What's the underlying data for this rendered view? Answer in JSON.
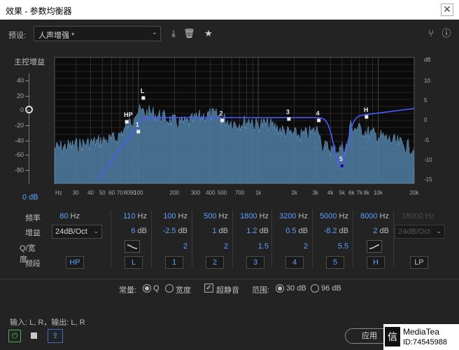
{
  "window": {
    "title": "效果 - 参数均衡器",
    "close_glyph": "✕"
  },
  "preset": {
    "label": "预设:",
    "value": "人声增强 *"
  },
  "toolbar": {
    "save_glyph": "⤓",
    "delete_glyph": "🗑",
    "favorite_glyph": "★",
    "route_glyph": "⑂",
    "info_glyph": "ⓘ"
  },
  "master": {
    "label": "主控增益",
    "value": "0 dB",
    "ticks": [
      "40",
      "20",
      "0",
      "-20",
      "-40",
      "-60",
      "-80"
    ]
  },
  "graph": {
    "db_label": "dB",
    "right_db_ticks": [
      "dB",
      "10",
      "5",
      "0",
      "-5",
      "-10",
      "-15"
    ],
    "freq_ticks": [
      "Hz",
      "30",
      "40",
      "50",
      "60",
      "70",
      "80",
      "90",
      "100",
      "200",
      "300",
      "400",
      "500",
      "700",
      "1k",
      "2k",
      "3k",
      "4k",
      "5k",
      "6k",
      "7k",
      "8k",
      "10k",
      "20k"
    ],
    "colors": {
      "background": "#0b0b0b",
      "spectrum": "#4f7fa6",
      "curve": "#4a5cff",
      "grid": "#4a4a4a"
    },
    "nodes": [
      {
        "label": "HP",
        "freq": 80,
        "gain": -28
      },
      {
        "label": "L",
        "freq": 110,
        "gain": 12
      },
      {
        "label": "1",
        "freq": 100,
        "gain": -40
      },
      {
        "label": "2",
        "freq": 500,
        "gain": 0
      },
      {
        "label": "3",
        "freq": 1800,
        "gain": 2
      },
      {
        "label": "4",
        "freq": 3200,
        "gain": 0
      },
      {
        "label": "5",
        "freq": 5000,
        "gain": -65
      },
      {
        "label": "H",
        "freq": 8000,
        "gain": 5
      }
    ]
  },
  "rows": {
    "freq_label": "频率",
    "gain_label": "增益",
    "q_label": "Q/宽度",
    "band_label": "频段",
    "hz": "Hz",
    "db": "dB"
  },
  "hp": {
    "freq": "80",
    "slope": "24dB/Oct",
    "band": "HP"
  },
  "bands": [
    {
      "freq": "110",
      "gain": "6",
      "q": "~",
      "band": "L",
      "shape": "low-shelf"
    },
    {
      "freq": "100",
      "gain": "-2.5",
      "q": "2",
      "band": "1"
    },
    {
      "freq": "500",
      "gain": "1",
      "q": "2",
      "band": "2"
    },
    {
      "freq": "1800",
      "gain": "1.2",
      "q": "1.5",
      "band": "3"
    },
    {
      "freq": "3200",
      "gain": "0.5",
      "q": "2",
      "band": "4"
    },
    {
      "freq": "5000",
      "gain": "-8.2",
      "q": "5.5",
      "band": "5"
    },
    {
      "freq": "8000",
      "gain": "2",
      "q": "~",
      "band": "H",
      "shape": "high-shelf"
    }
  ],
  "lp": {
    "freq": "18000",
    "slope": "24dB/Oct",
    "band": "LP"
  },
  "options": {
    "constant_label": "常量:",
    "q_option": "Q",
    "width_option": "宽度",
    "ultra_quiet": "超静音",
    "range_label": "范围:",
    "range_30": "30 dB",
    "range_96": "96 dB"
  },
  "footer": {
    "io": "输入: L, R，输出: L, R",
    "power_glyph": "⏻",
    "export_glyph": "⇪",
    "apply": "应用"
  },
  "watermark": {
    "logo": "信",
    "line1": "MediaTea",
    "line2": "ID:74545988"
  }
}
